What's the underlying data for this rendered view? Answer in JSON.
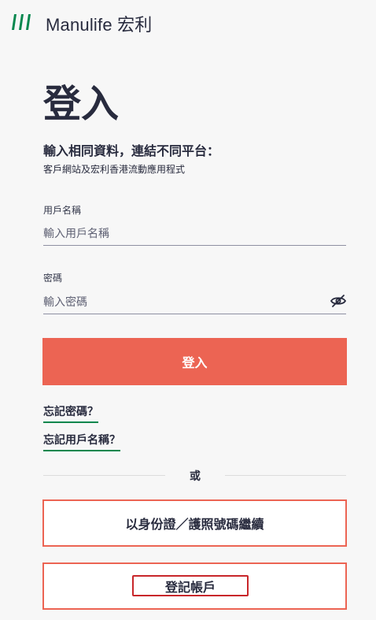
{
  "header": {
    "brand": "Manulife 宏利"
  },
  "login": {
    "title": "登入",
    "subtitle": "輸入相同資料，連結不同平台：",
    "subtitle_detail": "客戶網站及宏利香港流動應用程式",
    "username_label": "用戶名稱",
    "username_placeholder": "輸入用戶名稱",
    "username_value": "",
    "password_label": "密碼",
    "password_placeholder": "輸入密碼",
    "password_value": "",
    "submit_label": "登入",
    "forgot_password": "忘記密碼？",
    "forgot_username": "忘記用戶名稱？",
    "or_label": "或",
    "id_continue_label": "以身份證／護照號碼繼續",
    "register_label": "登記帳戶"
  },
  "colors": {
    "brand_green": "#06874e",
    "primary_coral": "#ec6453",
    "text_dark": "#282b3e",
    "highlight_red": "#c8262a"
  },
  "icons": {
    "logo": "manulife-logo-icon",
    "password_toggle": "eye-slash-icon"
  }
}
